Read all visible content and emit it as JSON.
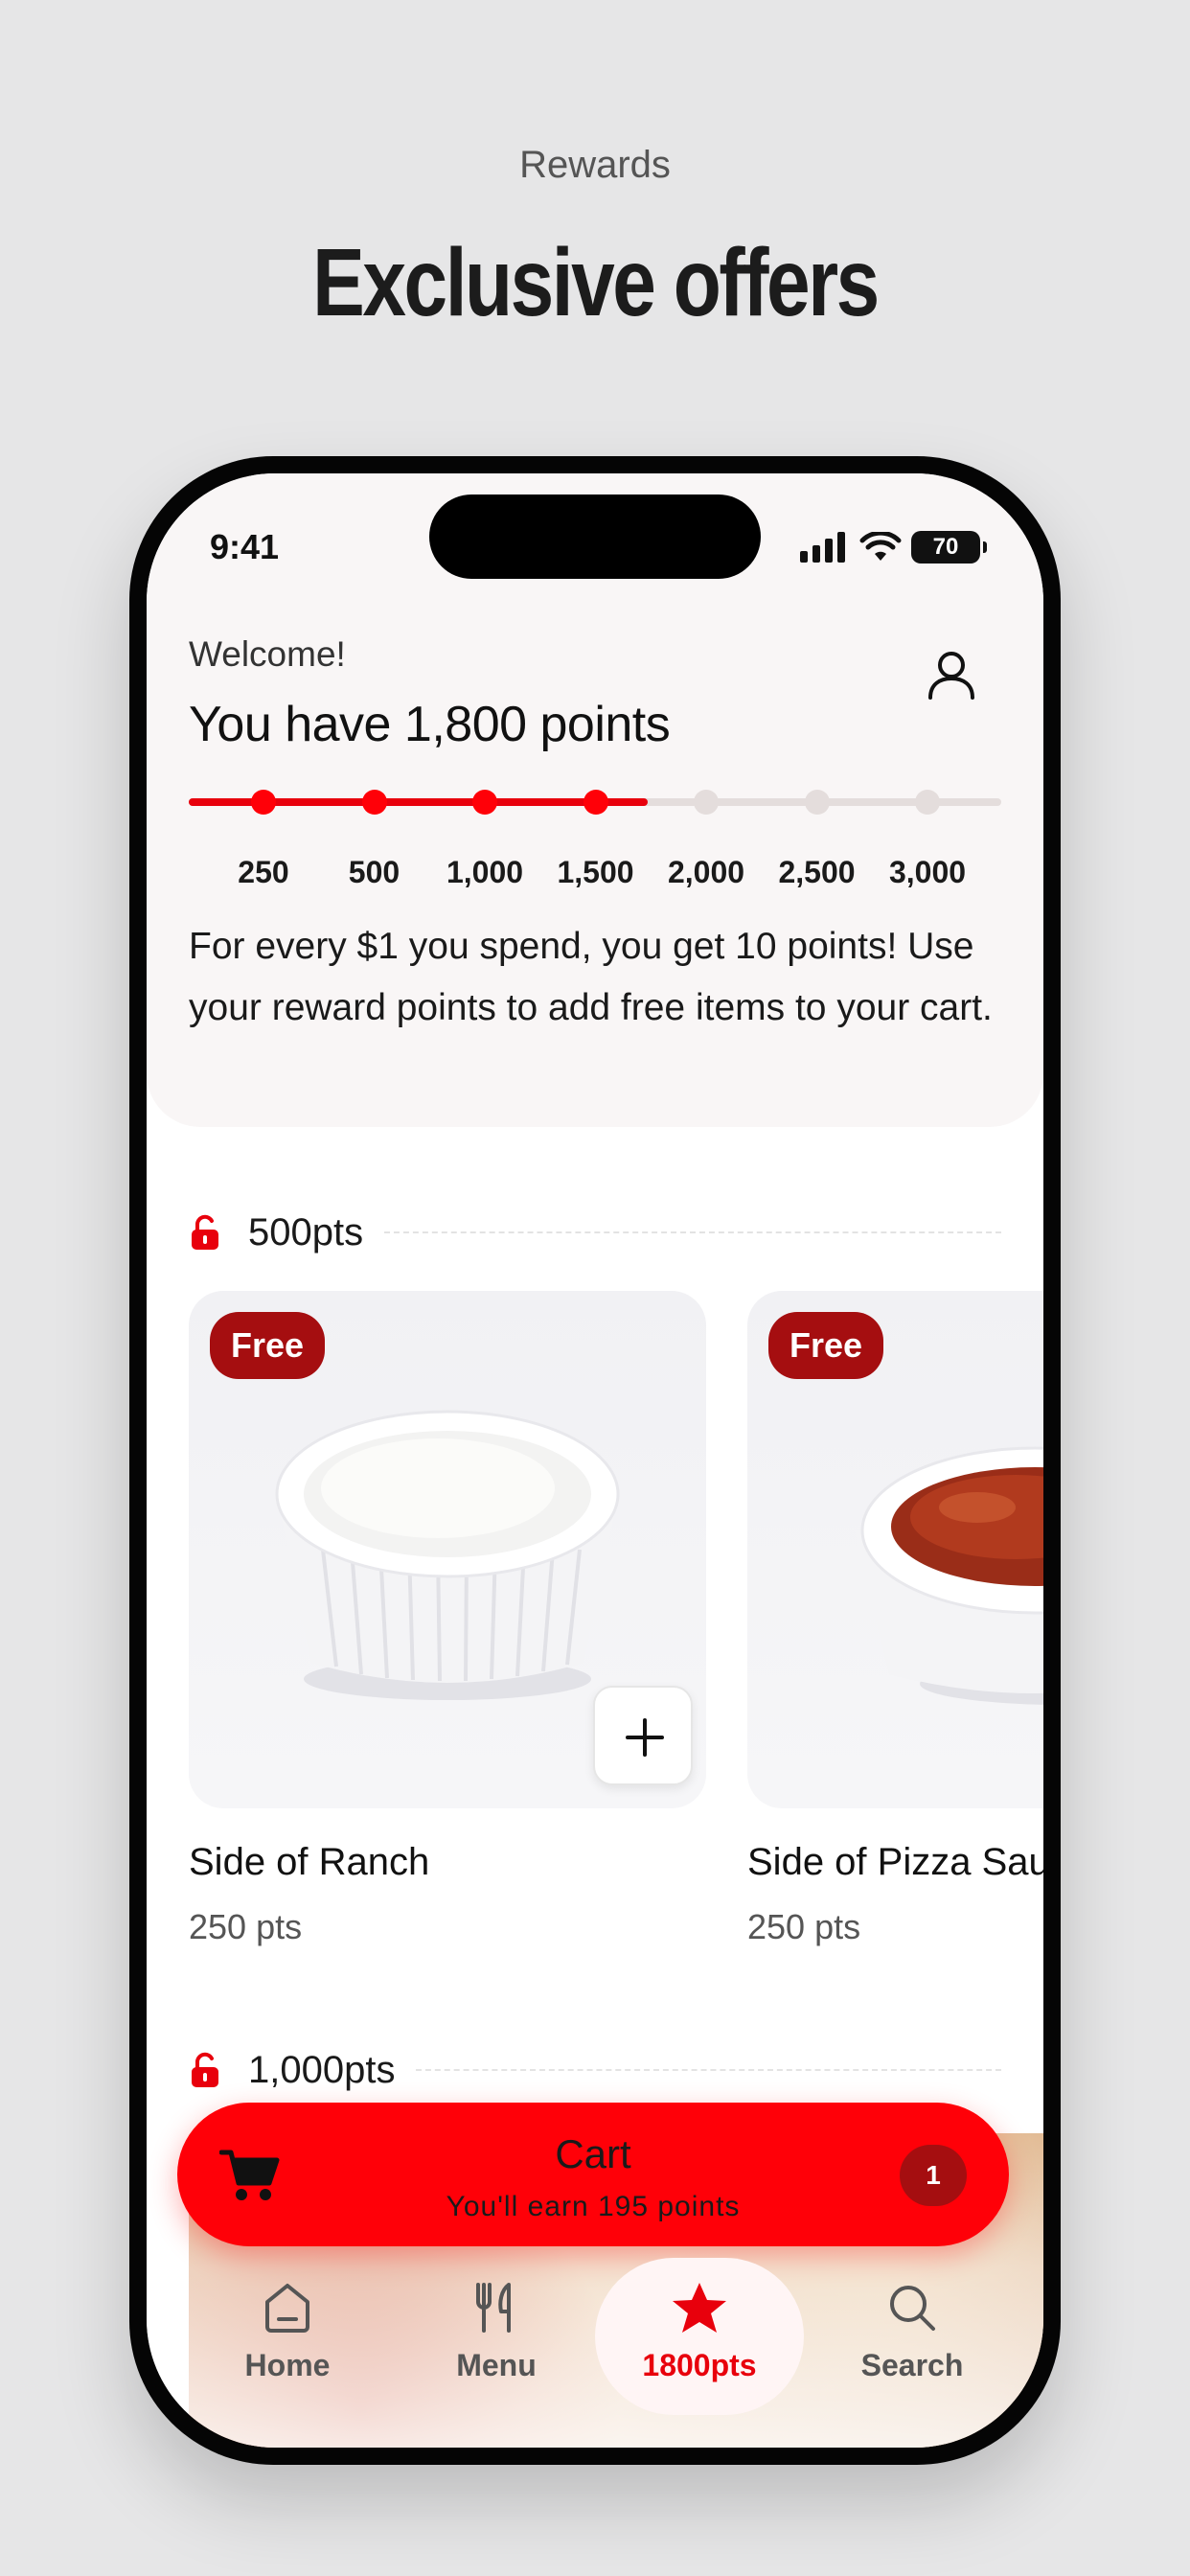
{
  "hero": {
    "subtitle": "Rewards",
    "title": "Exclusive offers"
  },
  "status_bar": {
    "time": "9:41",
    "battery": "70"
  },
  "header": {
    "welcome": "Welcome!",
    "points_title": "You have 1,800 points",
    "points": 1800,
    "milestones": [
      "250",
      "500",
      "1,000",
      "1,500",
      "2,000",
      "2,500",
      "3,000"
    ],
    "milestones_reached": 4,
    "progress_fraction": 0.565,
    "explanation": "For every $1 you spend, you get 10 points! Use your reward points to add free items to your cart."
  },
  "tiers": [
    {
      "label": "500pts",
      "items": [
        {
          "badge": "Free",
          "name": "Side of Ranch",
          "points": "250 pts",
          "image": "ranch-cup"
        },
        {
          "badge": "Free",
          "name": "Side of Pizza Sauce",
          "points": "250 pts",
          "image": "pizza-sauce-cup"
        }
      ]
    },
    {
      "label": "1,000pts"
    }
  ],
  "cart": {
    "title": "Cart",
    "subtitle": "You'll earn 195 points",
    "count": "1"
  },
  "tabbar": {
    "tabs": [
      {
        "label": "Home",
        "icon": "home-icon"
      },
      {
        "label": "Menu",
        "icon": "fork-knife-icon"
      },
      {
        "label": "1800pts",
        "icon": "star-icon",
        "active": true
      },
      {
        "label": "Search",
        "icon": "search-icon"
      }
    ]
  },
  "colors": {
    "accent": "#ff0008",
    "badge": "#a50e10",
    "track": "#e4dddc",
    "panel": "#f9f6f6"
  }
}
